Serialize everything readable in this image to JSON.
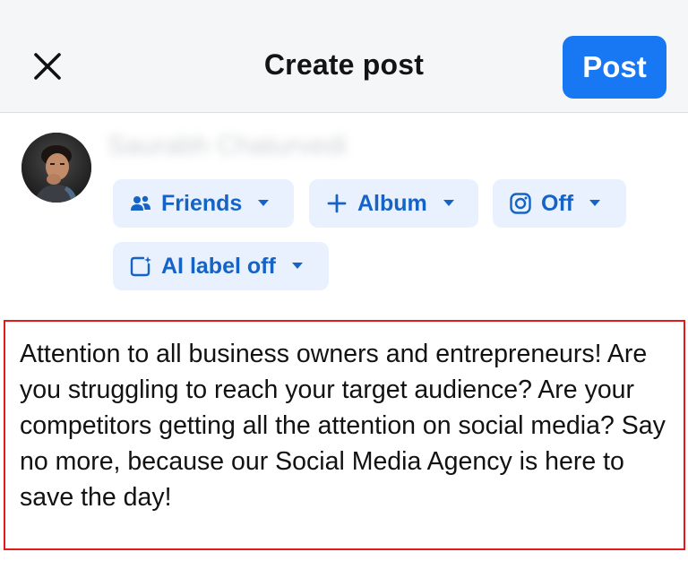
{
  "header": {
    "title": "Create post",
    "close_icon": "close-icon",
    "post_label": "Post"
  },
  "profile": {
    "name": "Saurabh Chaturvedi",
    "avatar_icon": "avatar"
  },
  "audience_chips": [
    {
      "label": "Friends",
      "icon": "people-icon"
    },
    {
      "label": "Album",
      "icon": "plus-icon"
    },
    {
      "label": "Off",
      "icon": "instagram-icon"
    },
    {
      "label": "AI label off",
      "icon": "ai-label-icon"
    }
  ],
  "composer": {
    "text": "Attention to all business owners and entrepreneurs! Are you struggling to reach your target audience? Are your competitors getting all the attention on social media? Say no more, because our Social Media Agency is here to save the day!"
  },
  "colors": {
    "accent": "#1877f2",
    "chip_bg": "#e8f1fd",
    "chip_text": "#1563c6",
    "highlight_border": "#e31a1a"
  }
}
